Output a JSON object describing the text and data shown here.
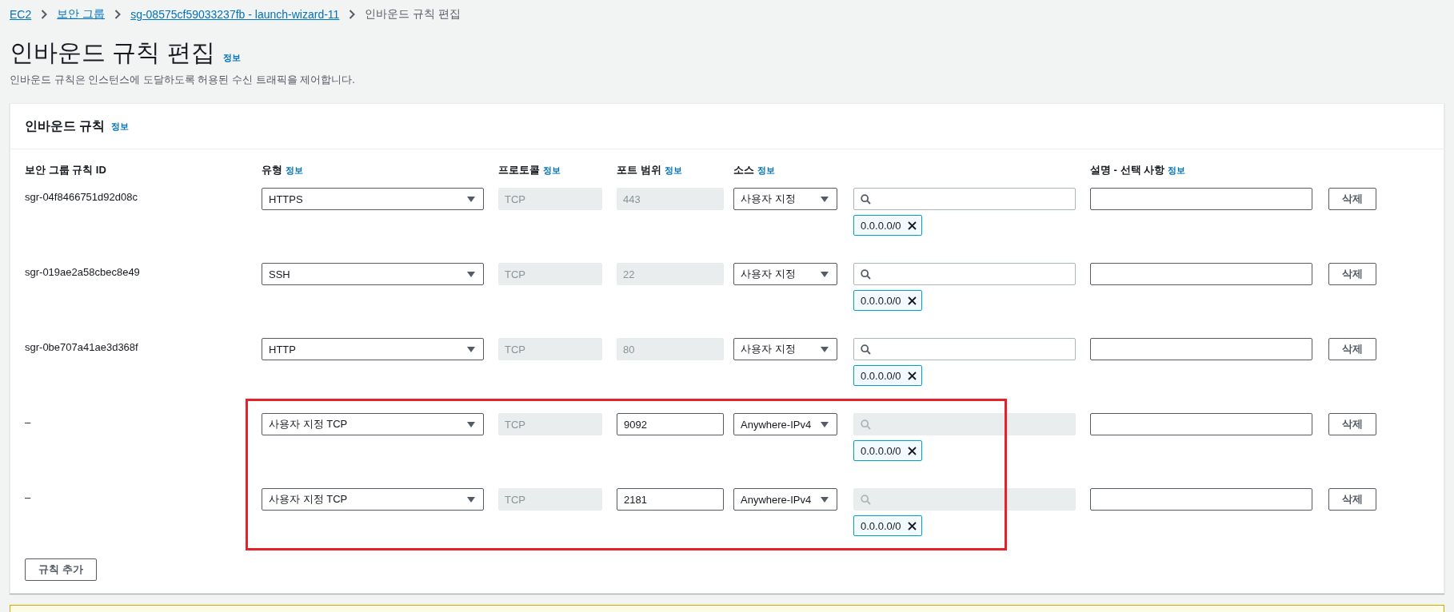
{
  "breadcrumbs": [
    {
      "label": "EC2",
      "link": true
    },
    {
      "label": "보안 그룹",
      "link": true
    },
    {
      "label": "sg-08575cf59033237fb - launch-wizard-11",
      "link": true
    },
    {
      "label": "인바운드 규칙 편집",
      "link": false
    }
  ],
  "page": {
    "title": "인바운드 규칙 편집",
    "info": "정보",
    "description": "인바운드 규칙은 인스턴스에 도달하도록 허용된 수신 트래픽을 제어합니다."
  },
  "panel": {
    "title": "인바운드 규칙",
    "info": "정보"
  },
  "columns": [
    {
      "label": "보안 그룹 규칙 ID"
    },
    {
      "label": "유형",
      "info": "정보"
    },
    {
      "label": "프로토콜",
      "info": "정보"
    },
    {
      "label": "포트 범위",
      "info": "정보"
    },
    {
      "label": "소스",
      "info": "정보"
    },
    {
      "label": "설명 - 선택 사항",
      "info": "정보"
    }
  ],
  "rows": [
    {
      "id": "sgr-04f8466751d92d08c",
      "type": "HTTPS",
      "protocol": "TCP",
      "port": "443",
      "port_disabled": true,
      "source": "사용자 지정",
      "search_disabled": false,
      "tags": [
        "0.0.0.0/0"
      ],
      "delete": "삭제",
      "highlighted": false
    },
    {
      "id": "sgr-019ae2a58cbec8e49",
      "type": "SSH",
      "protocol": "TCP",
      "port": "22",
      "port_disabled": true,
      "source": "사용자 지정",
      "search_disabled": false,
      "tags": [
        "0.0.0.0/0"
      ],
      "delete": "삭제",
      "highlighted": false
    },
    {
      "id": "sgr-0be707a41ae3d368f",
      "type": "HTTP",
      "protocol": "TCP",
      "port": "80",
      "port_disabled": true,
      "source": "사용자 지정",
      "search_disabled": false,
      "tags": [
        "0.0.0.0/0"
      ],
      "delete": "삭제",
      "highlighted": false
    },
    {
      "id": "–",
      "type": "사용자 지정 TCP",
      "protocol": "TCP",
      "port": "9092",
      "port_disabled": false,
      "source": "Anywhere-IPv4",
      "search_disabled": true,
      "tags": [
        "0.0.0.0/0"
      ],
      "delete": "삭제",
      "highlighted": true
    },
    {
      "id": "–",
      "type": "사용자 지정 TCP",
      "protocol": "TCP",
      "port": "2181",
      "port_disabled": false,
      "source": "Anywhere-IPv4",
      "search_disabled": true,
      "tags": [
        "0.0.0.0/0"
      ],
      "delete": "삭제",
      "highlighted": true
    }
  ],
  "add_button": "규칙 추가"
}
